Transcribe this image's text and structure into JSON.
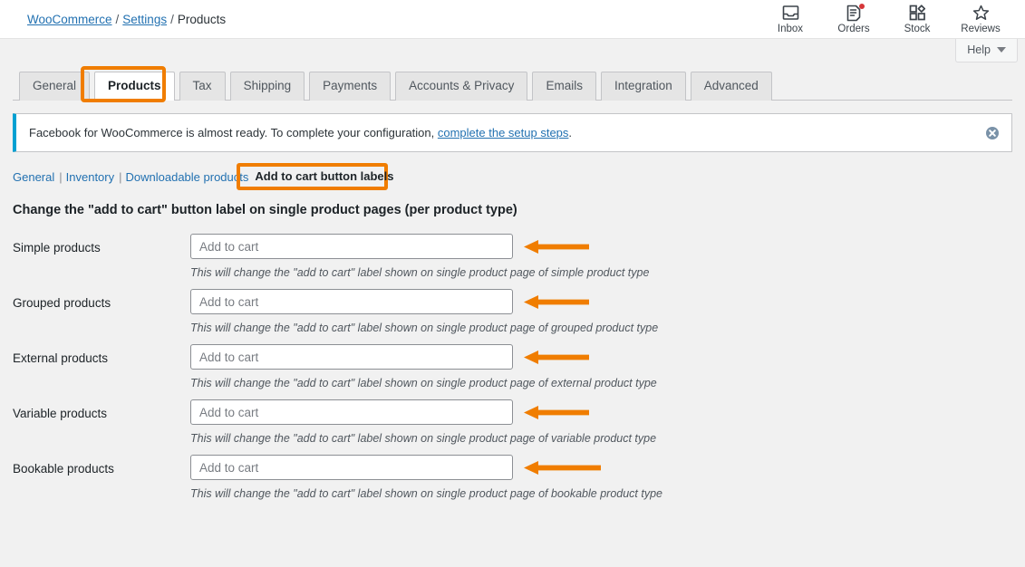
{
  "header": {
    "breadcrumb": {
      "root": "WooCommerce",
      "sep1": "/",
      "settings": "Settings",
      "sep2": "/",
      "current": "Products"
    },
    "activity_items": [
      {
        "label": "Inbox",
        "icon": "inbox-icon",
        "badge": false
      },
      {
        "label": "Orders",
        "icon": "orders-icon",
        "badge": true
      },
      {
        "label": "Stock",
        "icon": "stock-icon",
        "badge": false
      },
      {
        "label": "Reviews",
        "icon": "reviews-star-icon",
        "badge": false
      }
    ],
    "help_label": "Help"
  },
  "tabs": [
    {
      "label": "General",
      "active": false
    },
    {
      "label": "Products",
      "active": true
    },
    {
      "label": "Tax",
      "active": false
    },
    {
      "label": "Shipping",
      "active": false
    },
    {
      "label": "Payments",
      "active": false
    },
    {
      "label": "Accounts & Privacy",
      "active": false
    },
    {
      "label": "Emails",
      "active": false
    },
    {
      "label": "Integration",
      "active": false
    },
    {
      "label": "Advanced",
      "active": false
    }
  ],
  "notice": {
    "text_before": "Facebook for WooCommerce is almost ready. To complete your configuration, ",
    "link_text": "complete the setup steps",
    "text_after": ".",
    "dismiss_icon": "close-circle-icon"
  },
  "subnav": {
    "links": [
      "General",
      "Inventory",
      "Downloadable products"
    ],
    "separator": "|",
    "current": "Add to cart button labels"
  },
  "section_title": "Change the \"add to cart\" button label on single product pages (per product type)",
  "fields": [
    {
      "label": "Simple products",
      "value": "",
      "placeholder": "Add to cart",
      "description": "This will change the \"add to cart\" label shown on single product page of simple product type"
    },
    {
      "label": "Grouped products",
      "value": "",
      "placeholder": "Add to cart",
      "description": "This will change the \"add to cart\" label shown on single product page of grouped product type"
    },
    {
      "label": "External products",
      "value": "",
      "placeholder": "Add to cart",
      "description": "This will change the \"add to cart\" label shown on single product page of external product type"
    },
    {
      "label": "Variable products",
      "value": "",
      "placeholder": "Add to cart",
      "description": "This will change the \"add to cart\" label shown on single product page of variable product type"
    },
    {
      "label": "Bookable products",
      "value": "",
      "placeholder": "Add to cart",
      "description": "This will change the \"add to cart\" label shown on single product page of bookable product type"
    }
  ],
  "colors": {
    "annotation_orange": "#f07d00",
    "link_blue": "#2271b1",
    "notice_stripe": "#00a0d2",
    "badge_red": "#d63638",
    "page_bg": "#f1f1f1"
  }
}
